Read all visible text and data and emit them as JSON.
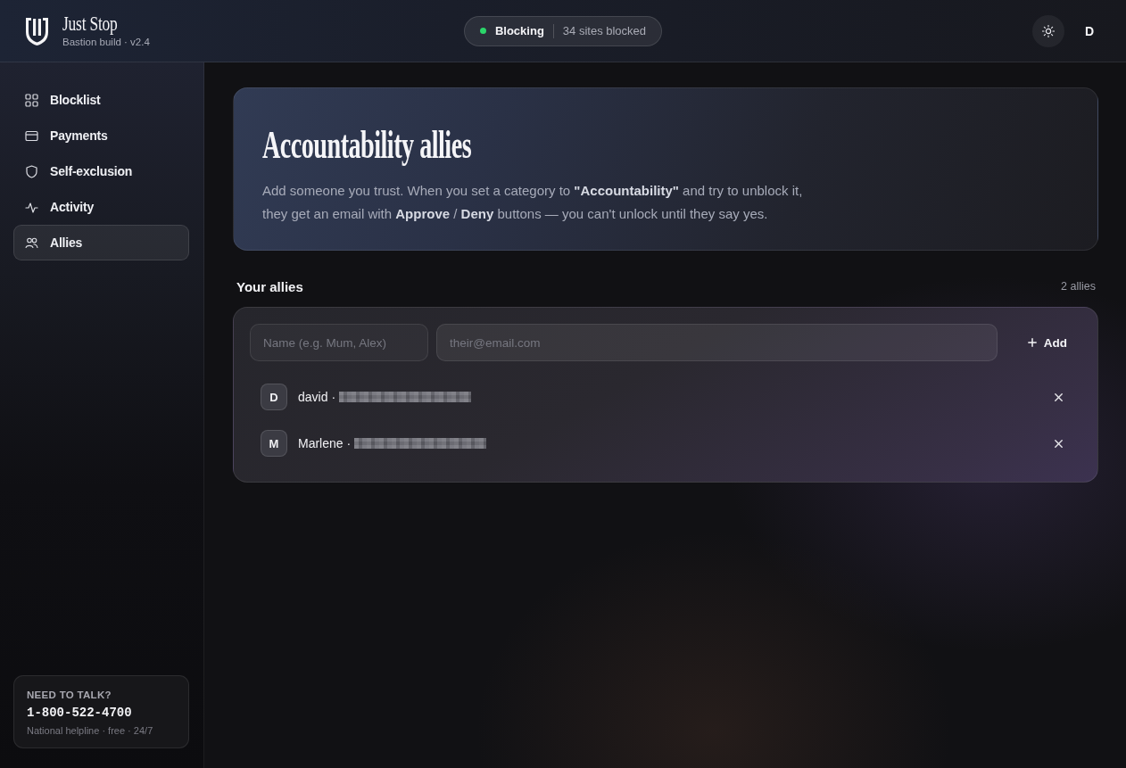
{
  "app": {
    "name": "Just Stop",
    "subtitle": "Bastion build · v2.4"
  },
  "status": {
    "active": true,
    "label": "Blocking",
    "detail": "34 sites blocked"
  },
  "account": {
    "initial": "D"
  },
  "sidebar": {
    "items": [
      {
        "label": "Blocklist",
        "selected": false
      },
      {
        "label": "Payments",
        "selected": false
      },
      {
        "label": "Self-exclusion",
        "selected": false
      },
      {
        "label": "Activity",
        "selected": false
      },
      {
        "label": "Allies",
        "selected": true
      }
    ],
    "help": {
      "title": "NEED TO TALK?",
      "phone": "1-800-522-4700",
      "note": "National helpline · free · 24/7"
    }
  },
  "hero": {
    "title": "Accountability allies",
    "description": "Add someone you trust. When you set a category to **\"Accountability\"** and try to unblock it, they get an email with **Approve** / **Deny** buttons — you can't unlock until they say yes."
  },
  "allies_section": {
    "title": "Your allies",
    "count": "2 allies",
    "form": {
      "name_placeholder": "Name (e.g. Mum, Alex)",
      "email_placeholder": "their@email.com",
      "add_button": "Add"
    },
    "allies": [
      {
        "initial": "D",
        "name": "david",
        "separator": "·",
        "email_redacted": true
      },
      {
        "initial": "M",
        "name": "Marlene",
        "separator": "·",
        "email_redacted": true
      }
    ]
  }
}
